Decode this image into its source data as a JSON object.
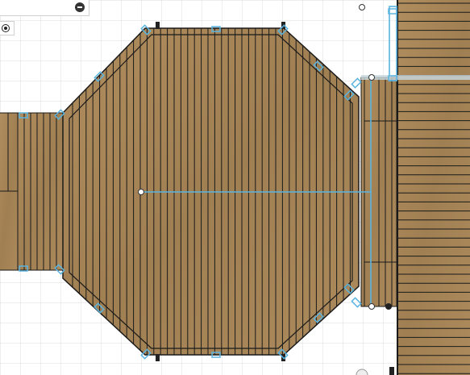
{
  "canvas": {
    "background": "#ffffff",
    "grid_color": "#dcdcdc",
    "wood_color": "#a8865a",
    "wood_dark": "#8a6a40",
    "board_line_color": "#1a1a1a",
    "selection_color": "#5ab4e0"
  },
  "panel": {
    "collapse_icon": "minus-circle-icon"
  },
  "tool": {
    "icon": "radio-target-icon"
  }
}
